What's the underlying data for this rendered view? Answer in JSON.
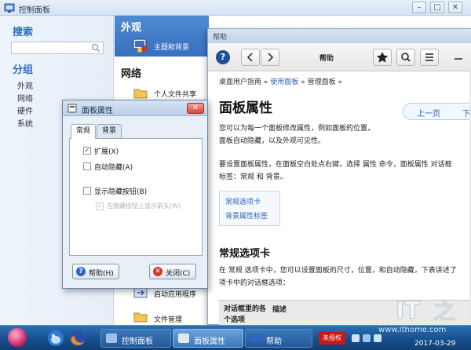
{
  "control_panel": {
    "title": "控制面板",
    "sidebar": {
      "search_heading": "搜索",
      "search_placeholder": "",
      "group_heading": "分组",
      "groups": [
        "外观",
        "网络",
        "硬件",
        "系统"
      ]
    },
    "categories": {
      "appearance": "外观",
      "theme_item": "主题和背景",
      "network": "网络",
      "personal_share": "个人文件共享",
      "startup_apps": "启动应用程序",
      "file_manager": "文件管理"
    },
    "window_buttons": [
      "–",
      "□",
      "✕"
    ]
  },
  "help_window": {
    "title": "帮助",
    "toolbar_title": "帮助",
    "breadcrumb": [
      "桌面用户指南",
      "使用面板",
      "管理面板"
    ],
    "breadcrumb_sep": "»",
    "page_title": "面板属性",
    "prev_label": "上一页",
    "next_label": "下",
    "para1_line1": "您可以为每一个面板修改属性，例如面板的位置，",
    "para1_line2": "面板自动隐藏，以及外观可见性。",
    "para2_line1": "要设置面板属性，在面板空白处点右键，选择 属性 命令，面板属性 对话框",
    "para2_line2": "标签：常规 和 背景。",
    "toc": [
      "常规选项卡",
      "背景属性标签"
    ],
    "section_title": "常规选项卡",
    "para3_line1": "在 常规 选项卡中，您可以设置面板的尺寸，位置，和自动隐藏，下表讲述了",
    "para3_line2": "项卡中的对话框选项：",
    "table_header": {
      "col1": "对话框里的各个选项",
      "col2": "描述"
    }
  },
  "dialog": {
    "title": "面板属性",
    "tabs": {
      "general": "常规",
      "background": "背景"
    },
    "options": {
      "expand": "扩展(X)",
      "autohide": "自动隐藏(A)",
      "show_hide_buttons": "显示隐藏按钮(B)",
      "arrows": "在隐藏按钮上显示箭头(W)"
    },
    "checked": {
      "expand": true,
      "autohide": false,
      "show_hide_buttons": false,
      "arrows": true
    },
    "help_button": "帮助(H)",
    "close_button": "关闭(C)",
    "close_x": "✕"
  },
  "taskbar": {
    "tasks": [
      {
        "label": "控制面板",
        "active": false
      },
      {
        "label": "面板属性",
        "active": true
      },
      {
        "label": "帮助",
        "active": false
      }
    ],
    "unauthorized_badge": "未授权",
    "date": "2017-03-29"
  },
  "watermark": {
    "url": "www.ithome.com"
  },
  "colors": {
    "accent": "#3670bf",
    "link": "#2a62b8",
    "taskbar": "#17508e",
    "badge": "#c81818"
  }
}
